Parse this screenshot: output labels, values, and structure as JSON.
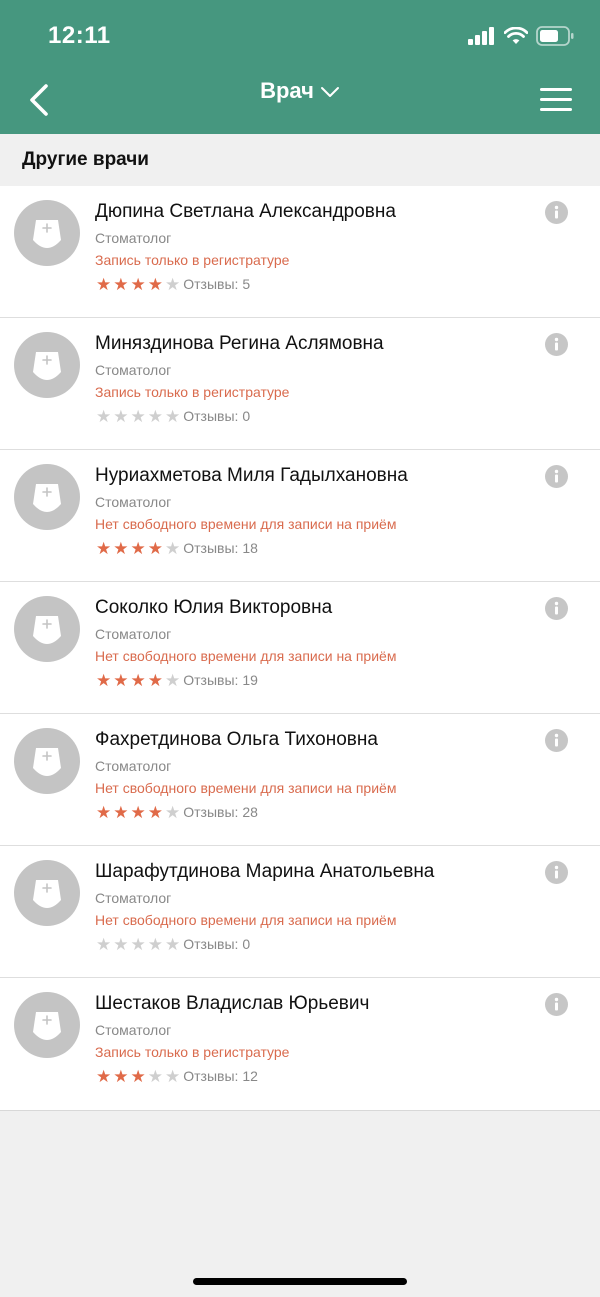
{
  "status_bar": {
    "time": "12:11"
  },
  "nav": {
    "title": "Врач"
  },
  "section": {
    "title": "Другие врачи"
  },
  "colors": {
    "header_bg": "#46977f",
    "status_text": "#d96b4e",
    "star_on": "#e06a48",
    "star_off": "#cfcfcf"
  },
  "icons": {
    "back": "chevron-left-icon",
    "menu": "hamburger-menu-icon",
    "title_dropdown": "chevron-down-icon",
    "info": "info-icon",
    "avatar": "doctor-avatar-icon"
  },
  "reviews_label": "Отзывы:",
  "doctors": [
    {
      "name": "Дюпина Светлана Александровна",
      "specialty": "Стоматолог",
      "status": "Запись только в регистратуре",
      "rating": 4,
      "reviews": "5"
    },
    {
      "name": "Миняздинова Регина Аслямовна",
      "specialty": "Стоматолог",
      "status": "Запись только в регистратуре",
      "rating": 0,
      "reviews": "0"
    },
    {
      "name": "Нуриахметова Миля Гадылхановна",
      "specialty": "Стоматолог",
      "status": "Нет свободного времени для записи на приём",
      "rating": 4,
      "reviews": "18"
    },
    {
      "name": "Соколко Юлия Викторовна",
      "specialty": "Стоматолог",
      "status": "Нет свободного времени для записи на приём",
      "rating": 4,
      "reviews": "19"
    },
    {
      "name": "Фахретдинова Ольга Тихоновна",
      "specialty": "Стоматолог",
      "status": "Нет свободного времени для записи на приём",
      "rating": 4,
      "reviews": "28"
    },
    {
      "name": "Шарафутдинова Марина Анатольевна",
      "specialty": "Стоматолог",
      "status": "Нет свободного времени для записи на приём",
      "rating": 0,
      "reviews": "0"
    },
    {
      "name": "Шестаков Владислав Юрьевич",
      "specialty": "Стоматолог",
      "status": "Запись только в регистратуре",
      "rating": 3,
      "reviews": "12"
    }
  ]
}
